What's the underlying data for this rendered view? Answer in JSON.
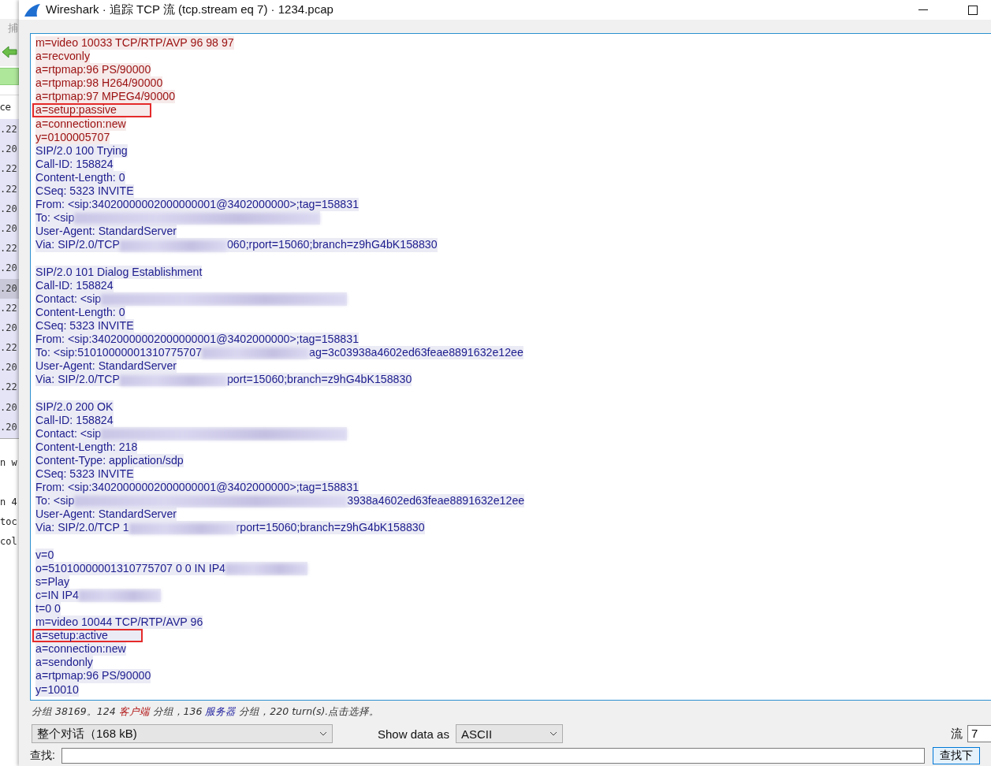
{
  "background_window": {
    "toolbar_label": "捕",
    "column_header": "ce",
    "rows": [
      {
        "text": ".22",
        "selected": false
      },
      {
        "text": ".20",
        "selected": false
      },
      {
        "text": ".22",
        "selected": false
      },
      {
        "text": ".22",
        "selected": false
      },
      {
        "text": ".20",
        "selected": false
      },
      {
        "text": ".20",
        "selected": false
      },
      {
        "text": ".22",
        "selected": false
      },
      {
        "text": ".20",
        "selected": false
      },
      {
        "text": ".20",
        "selected": true
      },
      {
        "text": ".22",
        "selected": false
      },
      {
        "text": ".20",
        "selected": false
      },
      {
        "text": ".22",
        "selected": false
      },
      {
        "text": ".20",
        "selected": false
      },
      {
        "text": ".22",
        "selected": false
      },
      {
        "text": ".20",
        "selected": false
      },
      {
        "text": ".20",
        "selected": false
      }
    ],
    "console_lines": [
      "n w",
      "n 4",
      "toc",
      "col"
    ]
  },
  "window": {
    "title": "Wireshark · 追踪 TCP 流 (tcp.stream eq 7) · 1234.pcap"
  },
  "stream": {
    "lines": [
      {
        "kind": "text",
        "color": "#9b1010",
        "marked": false,
        "parts": [
          {
            "kind": "text",
            "text": "m=video 10033 TCP/RTP/AVP 96 98 97"
          }
        ]
      },
      {
        "kind": "text",
        "color": "#9b1010",
        "marked": false,
        "parts": [
          {
            "kind": "text",
            "text": "a=recvonly"
          }
        ]
      },
      {
        "kind": "text",
        "color": "#9b1010",
        "marked": false,
        "parts": [
          {
            "kind": "text",
            "text": "a=rtpmap:96 PS/90000"
          }
        ]
      },
      {
        "kind": "text",
        "color": "#9b1010",
        "marked": false,
        "parts": [
          {
            "kind": "text",
            "text": "a=rtpmap:98 H264/90000"
          }
        ]
      },
      {
        "kind": "text",
        "color": "#9b1010",
        "marked": false,
        "parts": [
          {
            "kind": "text",
            "text": "a=rtpmap:97 MPEG4/90000"
          }
        ]
      },
      {
        "kind": "text",
        "color": "#9b1010",
        "marked": true,
        "parts": [
          {
            "kind": "text",
            "text": "a=setup:passive"
          }
        ]
      },
      {
        "kind": "text",
        "color": "#9b1010",
        "marked": false,
        "parts": [
          {
            "kind": "text",
            "text": "a=connection:new"
          }
        ]
      },
      {
        "kind": "text",
        "color": "#9b1010",
        "marked": false,
        "parts": [
          {
            "kind": "text",
            "text": "y=0100005707"
          }
        ]
      },
      {
        "kind": "text",
        "color": "#1c1c8e",
        "marked": false,
        "parts": [
          {
            "kind": "text",
            "text": "SIP/2.0 100 Trying"
          }
        ]
      },
      {
        "kind": "text",
        "color": "#1c1c8e",
        "marked": false,
        "parts": [
          {
            "kind": "text",
            "text": "Call-ID: 158824"
          }
        ]
      },
      {
        "kind": "text",
        "color": "#1c1c8e",
        "marked": false,
        "parts": [
          {
            "kind": "text",
            "text": "Content-Length: 0"
          }
        ]
      },
      {
        "kind": "text",
        "color": "#1c1c8e",
        "marked": false,
        "parts": [
          {
            "kind": "text",
            "text": "CSeq: 5323 INVITE"
          }
        ]
      },
      {
        "kind": "text",
        "color": "#1c1c8e",
        "marked": false,
        "parts": [
          {
            "kind": "text",
            "text": "From: <sip:34020000002000000001@3402000000>;tag=158831"
          }
        ]
      },
      {
        "kind": "text",
        "color": "#1c1c8e",
        "marked": false,
        "parts": [
          {
            "kind": "text",
            "text": "To: <sip"
          },
          {
            "kind": "blurlong"
          }
        ]
      },
      {
        "kind": "text",
        "color": "#1c1c8e",
        "marked": false,
        "parts": [
          {
            "kind": "text",
            "text": "User-Agent: StandardServer"
          }
        ]
      },
      {
        "kind": "text",
        "color": "#1c1c8e",
        "marked": false,
        "parts": [
          {
            "kind": "text",
            "text": "Via: SIP/2.0/TCP"
          },
          {
            "kind": "blurmedium"
          },
          {
            "kind": "text",
            "text": "060;rport=15060;branch=z9hG4bK158830"
          }
        ]
      },
      {
        "kind": "blank"
      },
      {
        "kind": "text",
        "color": "#1c1c8e",
        "marked": false,
        "parts": [
          {
            "kind": "text",
            "text": "SIP/2.0 101 Dialog Establishment"
          }
        ]
      },
      {
        "kind": "text",
        "color": "#1c1c8e",
        "marked": false,
        "parts": [
          {
            "kind": "text",
            "text": "Call-ID: 158824"
          }
        ]
      },
      {
        "kind": "text",
        "color": "#1c1c8e",
        "marked": false,
        "parts": [
          {
            "kind": "text",
            "text": "Contact: <sip"
          },
          {
            "kind": "blurlong"
          }
        ]
      },
      {
        "kind": "text",
        "color": "#1c1c8e",
        "marked": false,
        "parts": [
          {
            "kind": "text",
            "text": "Content-Length: 0"
          }
        ]
      },
      {
        "kind": "text",
        "color": "#1c1c8e",
        "marked": false,
        "parts": [
          {
            "kind": "text",
            "text": "CSeq: 5323 INVITE"
          }
        ]
      },
      {
        "kind": "text",
        "color": "#1c1c8e",
        "marked": false,
        "parts": [
          {
            "kind": "text",
            "text": "From: <sip:34020000002000000001@3402000000>;tag=158831"
          }
        ]
      },
      {
        "kind": "text",
        "color": "#1c1c8e",
        "marked": false,
        "parts": [
          {
            "kind": "text",
            "text": "To: <sip:51010000001310775707"
          },
          {
            "kind": "blurmedium"
          },
          {
            "kind": "text",
            "text": "ag=3c03938a4602ed63feae8891632e12ee"
          }
        ]
      },
      {
        "kind": "text",
        "color": "#1c1c8e",
        "marked": false,
        "parts": [
          {
            "kind": "text",
            "text": "User-Agent: StandardServer"
          }
        ]
      },
      {
        "kind": "text",
        "color": "#1c1c8e",
        "marked": false,
        "parts": [
          {
            "kind": "text",
            "text": "Via: SIP/2.0/TCP"
          },
          {
            "kind": "blurmedium"
          },
          {
            "kind": "text",
            "text": "port=15060;branch=z9hG4bK158830"
          }
        ]
      },
      {
        "kind": "blank"
      },
      {
        "kind": "text",
        "color": "#1c1c8e",
        "marked": false,
        "parts": [
          {
            "kind": "text",
            "text": "SIP/2.0 200 OK"
          }
        ]
      },
      {
        "kind": "text",
        "color": "#1c1c8e",
        "marked": false,
        "parts": [
          {
            "kind": "text",
            "text": "Call-ID: 158824"
          }
        ]
      },
      {
        "kind": "text",
        "color": "#1c1c8e",
        "marked": false,
        "parts": [
          {
            "kind": "text",
            "text": "Contact: <sip"
          },
          {
            "kind": "blurlong"
          }
        ]
      },
      {
        "kind": "text",
        "color": "#1c1c8e",
        "marked": false,
        "parts": [
          {
            "kind": "text",
            "text": "Content-Length: 218"
          }
        ]
      },
      {
        "kind": "text",
        "color": "#1c1c8e",
        "marked": false,
        "parts": [
          {
            "kind": "text",
            "text": "Content-Type: application/sdp"
          }
        ]
      },
      {
        "kind": "text",
        "color": "#1c1c8e",
        "marked": false,
        "parts": [
          {
            "kind": "text",
            "text": "CSeq: 5323 INVITE"
          }
        ]
      },
      {
        "kind": "text",
        "color": "#1c1c8e",
        "marked": false,
        "parts": [
          {
            "kind": "text",
            "text": "From: <sip:34020000002000000001@3402000000>;tag=158831"
          }
        ]
      },
      {
        "kind": "text",
        "color": "#1c1c8e",
        "marked": false,
        "parts": [
          {
            "kind": "text",
            "text": "To: <sip"
          },
          {
            "kind": "blurxlong"
          },
          {
            "kind": "text",
            "text": "3938a4602ed63feae8891632e12ee"
          }
        ]
      },
      {
        "kind": "text",
        "color": "#1c1c8e",
        "marked": false,
        "parts": [
          {
            "kind": "text",
            "text": "User-Agent: StandardServer"
          }
        ]
      },
      {
        "kind": "text",
        "color": "#1c1c8e",
        "marked": false,
        "parts": [
          {
            "kind": "text",
            "text": "Via: SIP/2.0/TCP 1"
          },
          {
            "kind": "blurmedium"
          },
          {
            "kind": "text",
            "text": "rport=15060;branch=z9hG4bK158830"
          }
        ]
      },
      {
        "kind": "blank"
      },
      {
        "kind": "text",
        "color": "#1c1c8e",
        "marked": false,
        "parts": [
          {
            "kind": "text",
            "text": "v=0"
          }
        ]
      },
      {
        "kind": "text",
        "color": "#1c1c8e",
        "marked": false,
        "parts": [
          {
            "kind": "text",
            "text": "o=51010000001310775707 0 0 IN IP4"
          },
          {
            "kind": "blurshort"
          }
        ]
      },
      {
        "kind": "text",
        "color": "#1c1c8e",
        "marked": false,
        "parts": [
          {
            "kind": "text",
            "text": "s=Play"
          }
        ]
      },
      {
        "kind": "text",
        "color": "#1c1c8e",
        "marked": false,
        "parts": [
          {
            "kind": "text",
            "text": "c=IN IP4"
          },
          {
            "kind": "blurshort"
          }
        ]
      },
      {
        "kind": "text",
        "color": "#1c1c8e",
        "marked": false,
        "parts": [
          {
            "kind": "text",
            "text": "t=0 0"
          }
        ]
      },
      {
        "kind": "text",
        "color": "#1c1c8e",
        "marked": false,
        "parts": [
          {
            "kind": "text",
            "text": "m=video 10044 TCP/RTP/AVP 96"
          }
        ]
      },
      {
        "kind": "text",
        "color": "#1c1c8e",
        "marked": true,
        "parts": [
          {
            "kind": "text",
            "text": "a=setup:active"
          }
        ]
      },
      {
        "kind": "text",
        "color": "#1c1c8e",
        "marked": false,
        "parts": [
          {
            "kind": "text",
            "text": "a=connection:new"
          }
        ]
      },
      {
        "kind": "text",
        "color": "#1c1c8e",
        "marked": false,
        "parts": [
          {
            "kind": "text",
            "text": "a=sendonly"
          }
        ]
      },
      {
        "kind": "text",
        "color": "#1c1c8e",
        "marked": false,
        "parts": [
          {
            "kind": "text",
            "text": "a=rtpmap:96 PS/90000"
          }
        ]
      },
      {
        "kind": "text",
        "color": "#1c1c8e",
        "marked": false,
        "parts": [
          {
            "kind": "text",
            "text": "y=10010"
          }
        ]
      }
    ]
  },
  "status": {
    "parts": [
      {
        "kind": "text",
        "text": "分组 38169。124 "
      },
      {
        "kind": "client",
        "text": "客户端"
      },
      {
        "kind": "text",
        "text": " 分组，136 "
      },
      {
        "kind": "server",
        "text": "服务器"
      },
      {
        "kind": "text",
        "text": " 分组，220 turn(s).点击选择。"
      }
    ]
  },
  "conversation_select": {
    "value": "整个对话（168 kB)"
  },
  "show_data_as": {
    "label": "Show data as",
    "value": "ASCII"
  },
  "stream_number": {
    "label": "流",
    "value": "7"
  },
  "find": {
    "label": "查找:",
    "button": "查找下"
  }
}
